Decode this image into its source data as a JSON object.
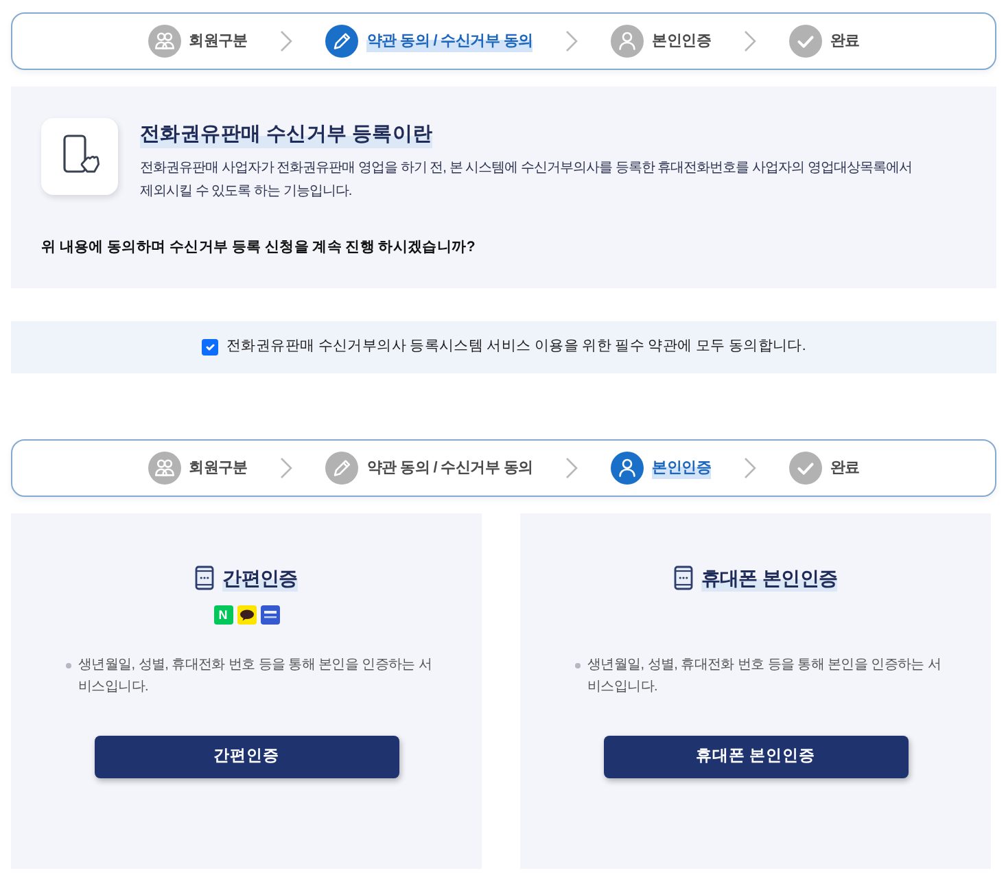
{
  "steppers": [
    {
      "steps": [
        {
          "kind": "group",
          "label": "회원구분",
          "selected": false
        },
        {
          "kind": "edit",
          "label": "약관 동의 / 수신거부 동의",
          "selected": true
        },
        {
          "kind": "user",
          "label": "본인인증",
          "selected": false
        },
        {
          "kind": "check",
          "label": "완료",
          "selected": false
        }
      ]
    },
    {
      "steps": [
        {
          "kind": "group",
          "label": "회원구분",
          "selected": false
        },
        {
          "kind": "edit",
          "label": "약관 동의 / 수신거부 동의",
          "selected": false
        },
        {
          "kind": "user",
          "label": "본인인증",
          "selected": true
        },
        {
          "kind": "check",
          "label": "완료",
          "selected": false
        }
      ]
    }
  ],
  "intro": {
    "title": "전화권유판매 수신거부 등록이란",
    "description": "전화권유판매 사업자가 전화권유판매 영업을 하기 전, 본 시스템에 수신거부의사를 등록한 휴대전화번호를 사업자의 영업대상목록에서 제외시킬 수 있도록 하는 기능입니다.",
    "question": "위 내용에 동의하며 수신거부 등록 신청을 계속 진행 하시겠습니까?"
  },
  "agreement": {
    "checked": true,
    "label": "전화권유판매 수신거부의사 등록시스템 서비스 이용을 위한 필수 약관에 모두 동의합니다."
  },
  "auth_options": [
    {
      "title": "간편인증",
      "logos": [
        {
          "kind": "letter",
          "text": "N",
          "color": "#03c75a"
        },
        {
          "kind": "bubble",
          "color": "#fee500"
        },
        {
          "kind": "card",
          "color": "#3559cf"
        }
      ],
      "description": "생년월일, 성별, 휴대전화 번호 등을 통해 본인을 인증하는 서비스입니다.",
      "button": "간편인증"
    },
    {
      "title": "휴대폰 본인인증",
      "description": "생년월일, 성별, 휴대전화 번호 등을 통해 본인을 인증하는 서비스입니다.",
      "button": "휴대폰 본인인증"
    }
  ]
}
